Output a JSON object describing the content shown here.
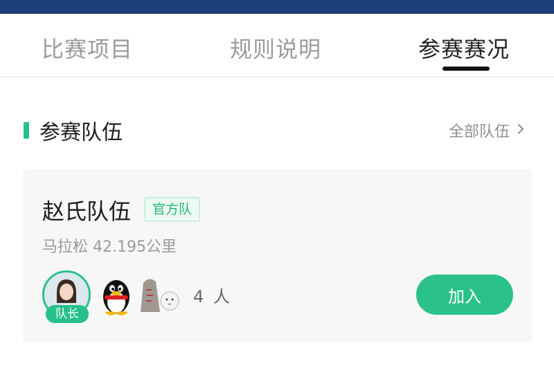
{
  "tabs": [
    {
      "label": "比赛项目"
    },
    {
      "label": "规则说明"
    },
    {
      "label": "参赛赛况",
      "active": true
    }
  ],
  "section": {
    "title": "参赛队伍",
    "all_link": "全部队伍",
    "all_link_icon": "chevron-right-icon"
  },
  "team": {
    "name": "赵氏队伍",
    "badge": "官方队",
    "description": "马拉松 42.195公里",
    "captain_label": "队长",
    "member_count": "4 人",
    "join_label": "加入"
  },
  "colors": {
    "accent": "#27c08a",
    "top_strip": "#1d3f78",
    "badge_text": "#22b47b"
  }
}
